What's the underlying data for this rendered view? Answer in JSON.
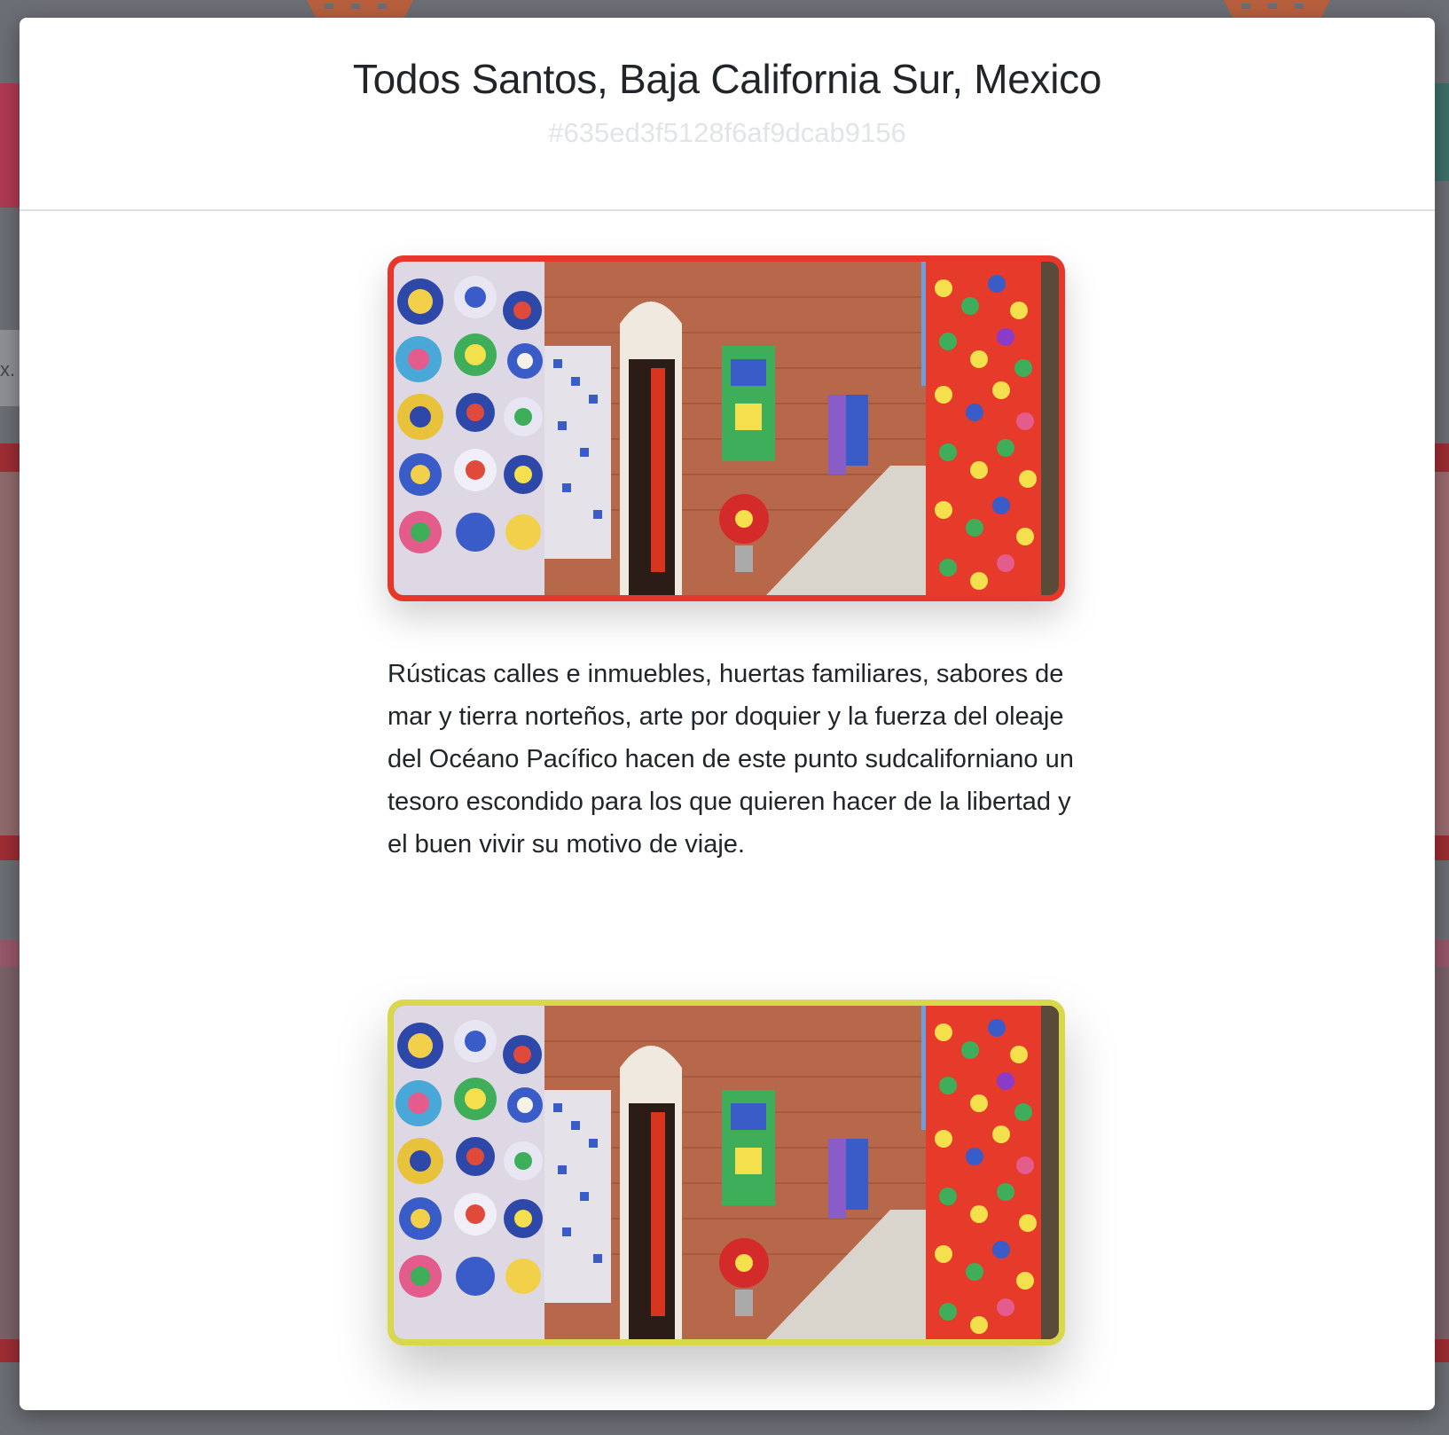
{
  "background": {
    "search_fragment": "x."
  },
  "modal": {
    "title": "Todos Santos, Baja California Sur, Mexico",
    "subtitle": "#635ed3f5128f6af9dcab9156",
    "description": "Rústicas calles e inmuebles, huertas familiares, sabores de mar y tierra norteños, arte por doquier y la fuerza del oleaje del Océano Pacífico hacen de este punto sudcaliforniano un tesoro escondido para los que quieren hacer de la libertad y el buen vivir su motivo de viaje.",
    "photo_border_colors": [
      "#e8372a",
      "#d8d84a"
    ]
  }
}
